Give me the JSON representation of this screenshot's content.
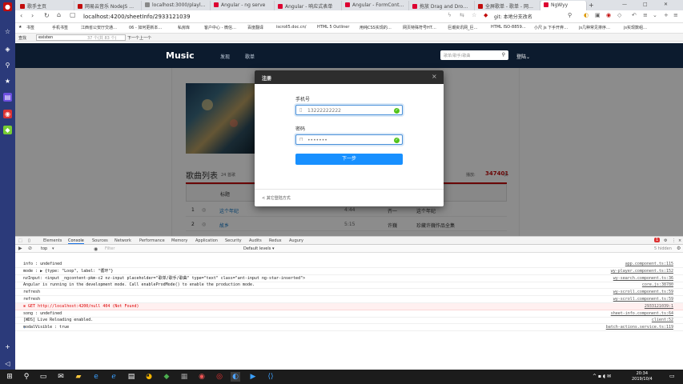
{
  "browser": {
    "tabs": [
      {
        "label": "歌手主页",
        "color": "#c20c0c"
      },
      {
        "label": "网易云音乐 NodeJS 版…",
        "color": "#c20c0c"
      },
      {
        "label": "localhost:3000/playlis…",
        "color": "#888888"
      },
      {
        "label": "Angular - ng serve",
        "color": "#dd0031"
      },
      {
        "label": "Angular - 响应式表单",
        "color": "#dd0031"
      },
      {
        "label": "Angular - FormControl",
        "color": "#dd0031"
      },
      {
        "label": "拖放 Drag and Drop…",
        "color": "#dd0031"
      },
      {
        "label": "全屏歌单 - 歌单 - 网易…",
        "color": "#c20c0c"
      },
      {
        "label": "NgWyy",
        "color": "#dd0031"
      }
    ],
    "new_tab": "+",
    "window_controls": [
      "—",
      "□",
      "✕"
    ],
    "url": "localhost:4200/sheetInfo/2933121039",
    "right_cluster": "git: 本地分支改名",
    "bookmarks": [
      "书签",
      "手机书签",
      "江西省公安厅交通…",
      "06 - 如何更新本…",
      "私房库",
      "客户中心 - 微信…",
      "百度翻译",
      "iscroll5.doc.cn/",
      "HTML 5 Outliner",
      "用纯CSS实现的…",
      "网页特殊符号HT…",
      "巨潮资讯网_巨…",
      "HTML ISO-8859…",
      "小尺 js 下手开弃…",
      "js几种常见排序…",
      "js实现数组…"
    ],
    "find": {
      "label": "查找",
      "value": "existen",
      "count": "37 个(共 83 个)",
      "next": "下一个",
      "prev": "上一个"
    }
  },
  "site": {
    "logo": "Music",
    "nav": [
      "发现",
      "歌单"
    ],
    "search_placeholder": "歌单/歌手/歌曲",
    "login": "登陆"
  },
  "sheet": {
    "list_title": "歌曲列表",
    "count": "24 首歌",
    "play_label": "播放:",
    "play_count": "347401",
    "play_unit": "次",
    "col_title": "标题",
    "rows": [
      {
        "index": "1",
        "title": "这个年纪",
        "duration": "4:44",
        "artist": "齐一",
        "album": "这个年纪"
      },
      {
        "index": "2",
        "title": "故乡",
        "duration": "5:15",
        "artist": "许巍",
        "album": "珍藏许巍作品全集"
      }
    ]
  },
  "modal": {
    "title": "注册",
    "close": "×",
    "phone_label": "手机号",
    "phone_value": "13222222222",
    "password_label": "密码",
    "password_value": "•••••••",
    "next_label": "下一步",
    "other_login": "< 其它登陆方式"
  },
  "devtools": {
    "tabs": [
      "Elements",
      "Console",
      "Sources",
      "Network",
      "Performance",
      "Memory",
      "Application",
      "Security",
      "Audits",
      "Redux",
      "Augury"
    ],
    "active_tab": "Console",
    "context": "top",
    "filter_placeholder": "Filter",
    "levels": "Default levels ▾",
    "hidden": "5 hidden",
    "errors_badge": "1",
    "logs": [
      {
        "text": "info : undefined",
        "src": "app.component.ts:115",
        "type": "log"
      },
      {
        "text": "mode : ▶ {type: \"Loop\", label: \"循环\"}",
        "src": "wy-player.component.ts:152",
        "type": "log"
      },
      {
        "text": "nzInput:  <input _ngcontent-pkm-c2 nz-input placeholder=\"歌单/歌手/歌曲\" type=\"text\" class=\"ant-input ng-star-inserted\">",
        "src": "wy-search.component.ts:36",
        "type": "log"
      },
      {
        "text": "Angular is running in the development mode. Call enableProdMode() to enable the production mode.",
        "src": "core.js:38780",
        "type": "log"
      },
      {
        "text": "refresh",
        "src": "wy-scroll.component.ts:59",
        "type": "log"
      },
      {
        "text": "refresh",
        "src": "wy-scroll.component.ts:59",
        "type": "log"
      },
      {
        "text": "GET http://localhost:4200/null 404 (Not Found)",
        "src": "2933121039:1",
        "type": "error"
      },
      {
        "text": "song : undefined",
        "src": "sheet-info.component.ts:64",
        "type": "log"
      },
      {
        "text": "[WDS] Live Reloading enabled.",
        "src": "client:52",
        "type": "log"
      },
      {
        "text": "modalVisible : true",
        "src": "batch-actions.service.ts:119",
        "type": "log"
      }
    ]
  },
  "taskbar": {
    "time": "20:34",
    "date": "2019/10/4"
  },
  "colors": {
    "brand_red": "#c20c0c",
    "nav_dark": "#0c1b2e",
    "primary_blue": "#1890ff",
    "success_green": "#52c41a"
  }
}
